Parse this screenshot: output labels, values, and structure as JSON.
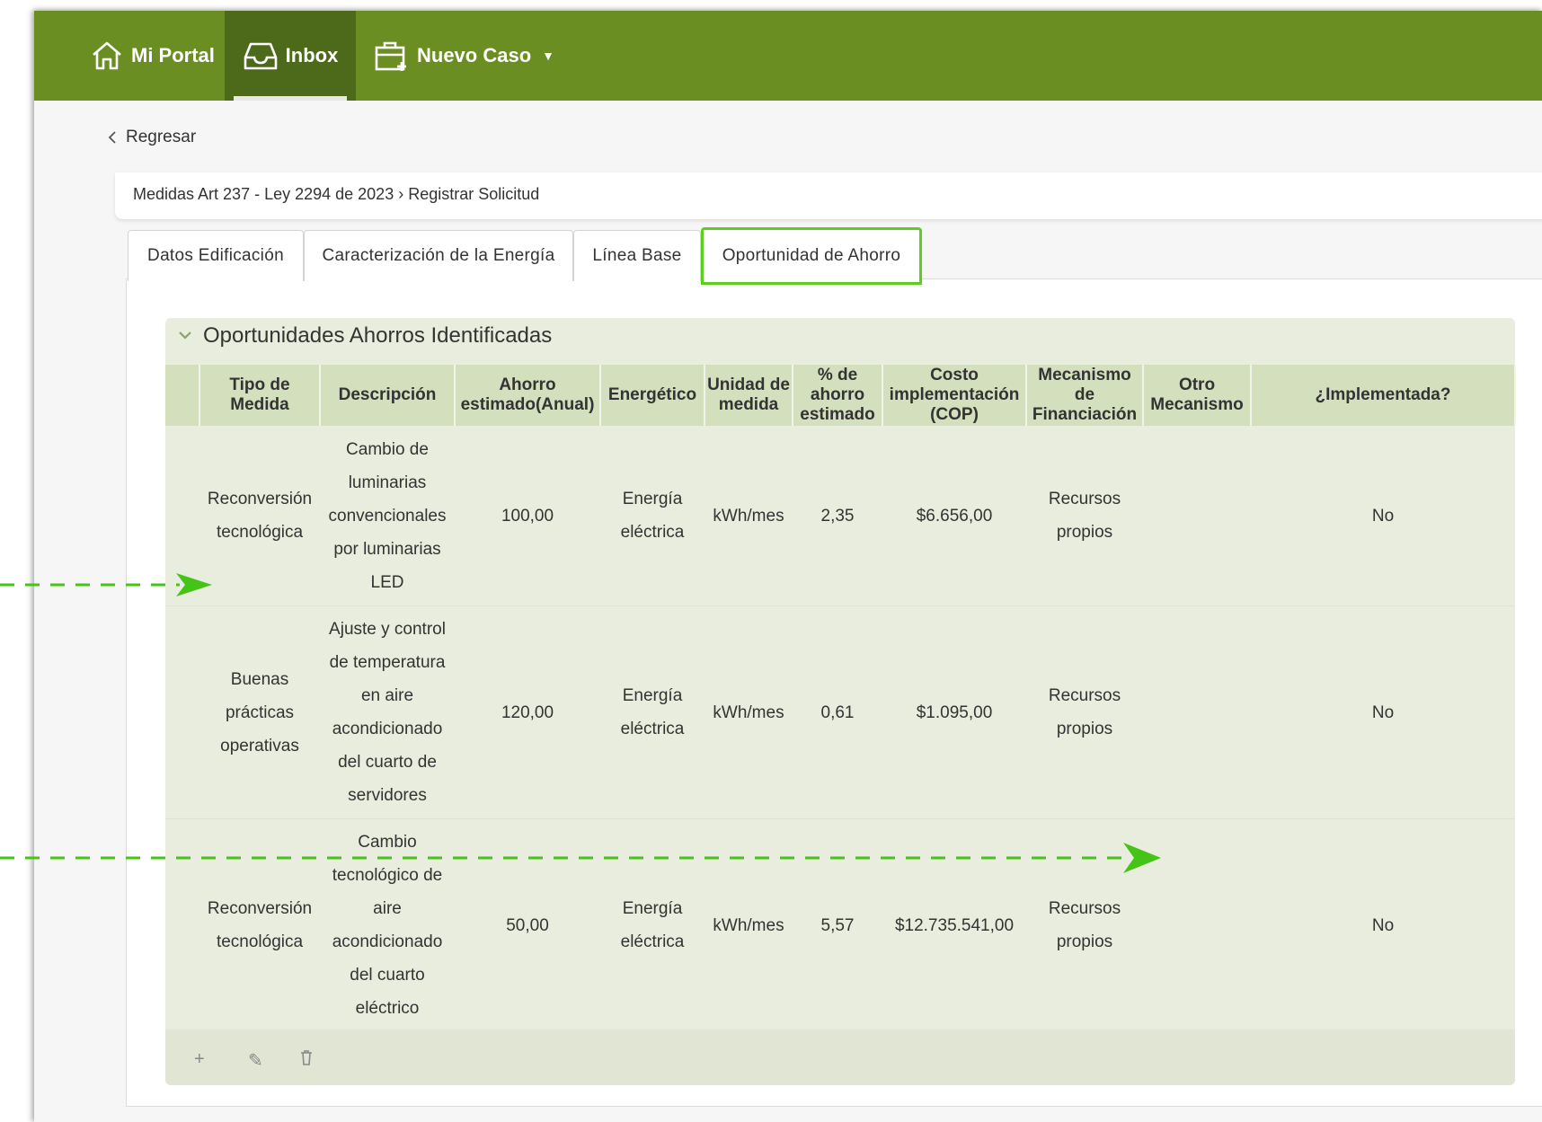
{
  "nav": {
    "items": [
      {
        "label": "Mi Portal",
        "icon": "home-icon"
      },
      {
        "label": "Inbox",
        "icon": "inbox-icon"
      },
      {
        "label": "Nuevo Caso",
        "icon": "new-case-icon"
      }
    ],
    "caret": "▼"
  },
  "back": {
    "label": "Regresar"
  },
  "breadcrumb": "Medidas Art 237 - Ley 2294 de 2023 › Registrar Solicitud",
  "tabs": [
    {
      "label": "Datos Edificación"
    },
    {
      "label": "Caracterización de la Energía"
    },
    {
      "label": "Línea Base"
    },
    {
      "label": "Oportunidad de Ahorro"
    }
  ],
  "section": {
    "title": "Oportunidades Ahorros Identificadas",
    "columns": [
      "",
      "Tipo de Medida",
      "Descripción",
      "Ahorro estimado(Anual)",
      "Energético",
      "Unidad de medida",
      "% de ahorro estimado",
      "Costo implementación (COP)",
      "Mecanismo de Financiación",
      "Otro Mecanismo",
      "¿Implementada?"
    ],
    "rows": [
      {
        "tipo": "Reconversión tecnológica",
        "descripcion": "Cambio de luminarias convencionales por luminarias LED",
        "ahorro": "100,00",
        "energetico": "Energía eléctrica",
        "unidad": "kWh/mes",
        "porcentaje": "2,35",
        "costo": "$6.656,00",
        "mecanismo": "Recursos propios",
        "otro": "",
        "implementada": "No"
      },
      {
        "tipo": "Buenas prácticas operativas",
        "descripcion": "Ajuste y control de temperatura en aire acondicionado del cuarto de servidores",
        "ahorro": "120,00",
        "energetico": "Energía eléctrica",
        "unidad": "kWh/mes",
        "porcentaje": "0,61",
        "costo": "$1.095,00",
        "mecanismo": "Recursos propios",
        "otro": "",
        "implementada": "No"
      },
      {
        "tipo": "Reconversión tecnológica",
        "descripcion": "Cambio tecnológico de aire acondicionado del cuarto eléctrico",
        "ahorro": "50,00",
        "energetico": "Energía eléctrica",
        "unidad": "kWh/mes",
        "porcentaje": "5,57",
        "costo": "$12.735.541,00",
        "mecanismo": "Recursos propios",
        "otro": "",
        "implementada": "No"
      }
    ]
  },
  "toolbar": {
    "add": "+",
    "edit": "✎",
    "delete": "🗑"
  },
  "colors": {
    "brand": "#6b8e23",
    "brand_dark": "#4d6a1a",
    "highlight": "#5ccf1e",
    "section_bg": "#e9eddd",
    "header_bg": "#d3dfbd"
  }
}
